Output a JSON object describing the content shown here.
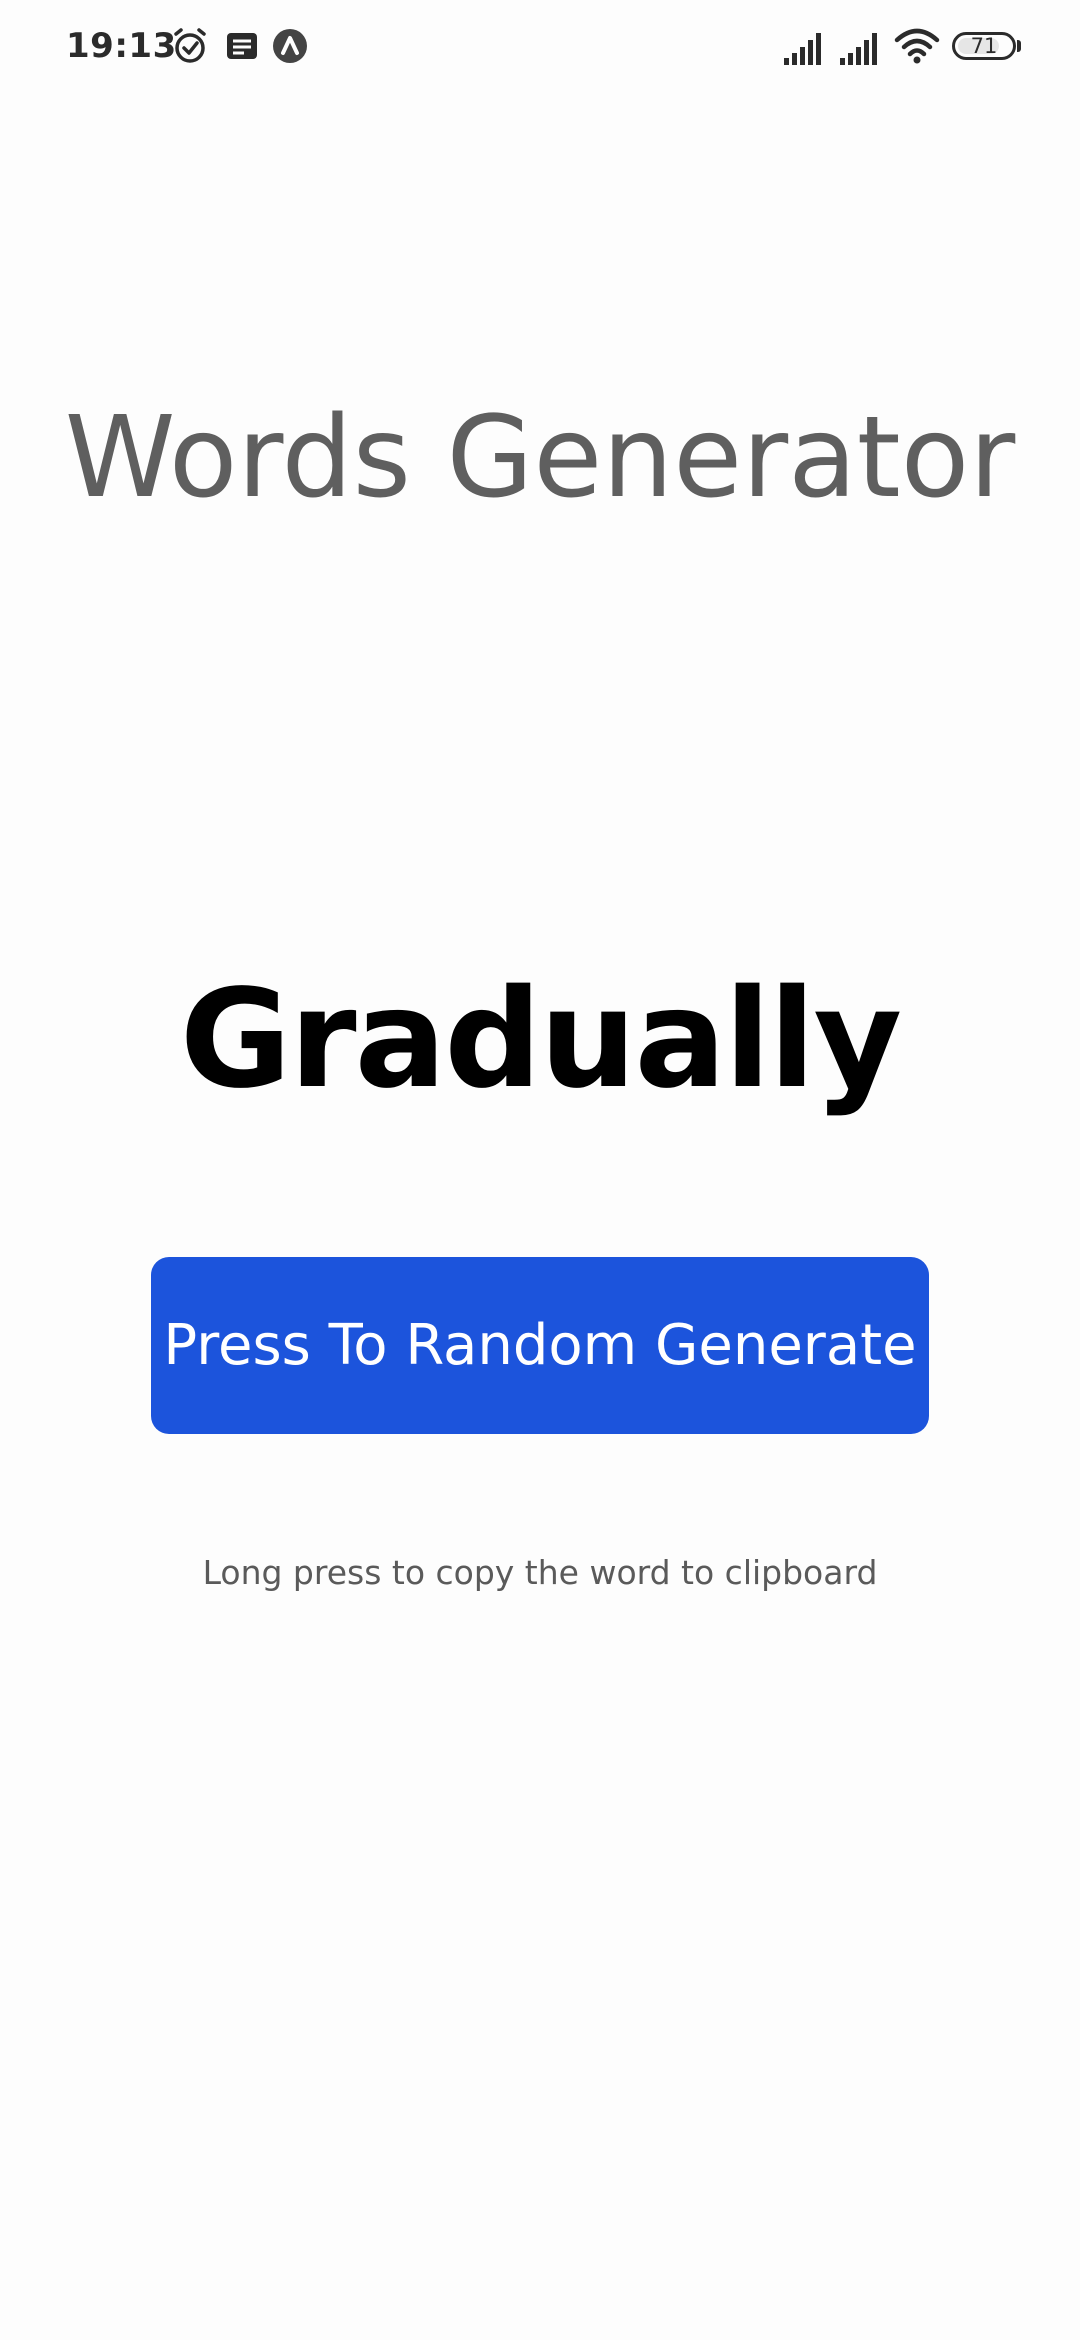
{
  "status_bar": {
    "time": "19:13",
    "icons": [
      "alarm-icon",
      "notes-icon",
      "app-icon",
      "signal-icon",
      "signal-icon",
      "wifi-icon"
    ],
    "battery_level": "71"
  },
  "app": {
    "title": "Words Generator",
    "generated_word": "Gradually",
    "generate_button_label": "Press To Random Generate",
    "hint": "Long press to copy the word to clipboard"
  },
  "colors": {
    "background": "#fdfdfd",
    "title": "#5f5f5f",
    "word": "#000000",
    "button": "#1c54dc",
    "button_text": "#ffffff",
    "hint": "#5a5a5a"
  }
}
